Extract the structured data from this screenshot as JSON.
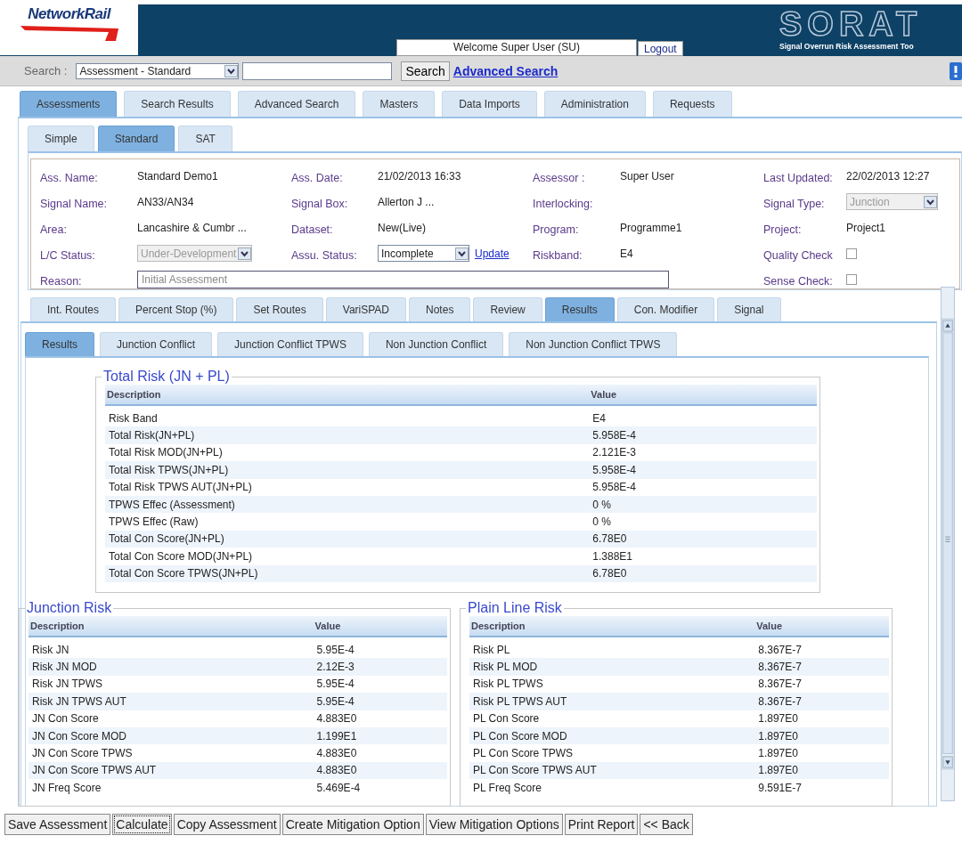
{
  "header": {
    "logo": "NetworkRail",
    "app_logo": "SORAT",
    "app_subtitle": "Signal Overrun Risk Assessment Too",
    "welcome": "Welcome Super User (SU)",
    "logout": "Logout"
  },
  "search": {
    "label": "Search :",
    "scope": "Assessment - Standard",
    "button": "Search",
    "advanced_link": "Advanced Search"
  },
  "main_tabs": [
    {
      "label": "Assessments",
      "selected": true
    },
    {
      "label": "Search Results",
      "selected": false
    },
    {
      "label": "Advanced Search",
      "selected": false
    },
    {
      "label": "Masters",
      "selected": false
    },
    {
      "label": "Data Imports",
      "selected": false
    },
    {
      "label": "Administration",
      "selected": false
    },
    {
      "label": "Requests",
      "selected": false
    }
  ],
  "sub_tabs": [
    {
      "label": "Simple",
      "selected": false
    },
    {
      "label": "Standard",
      "selected": true
    },
    {
      "label": "SAT",
      "selected": false
    }
  ],
  "form_rows": [
    [
      {
        "label": "Ass. Name:",
        "kind": "text",
        "value": "Standard Demo1"
      },
      {
        "label": "Ass. Date:",
        "kind": "text",
        "value": "21/02/2013 16:33"
      },
      {
        "label": "Assessor :",
        "kind": "text",
        "value": "Super User"
      },
      {
        "label": "Last Updated:",
        "kind": "text",
        "value": "22/02/2013 12:27"
      }
    ],
    [
      {
        "label": "Signal Name:",
        "kind": "text",
        "value": "AN33/AN34"
      },
      {
        "label": "Signal Box:",
        "kind": "text",
        "value": "Allerton J ..."
      },
      {
        "label": "Interlocking:",
        "kind": "text"
      },
      {
        "label": "Signal Type:",
        "kind": "select",
        "value": "Junction",
        "disabled": true
      }
    ],
    [
      {
        "label": "Area:",
        "kind": "text",
        "value": "Lancashire & Cumbr ..."
      },
      {
        "label": "Dataset:",
        "kind": "text",
        "value": "New(Live)"
      },
      {
        "label": "Program:",
        "kind": "text",
        "value": "Programme1"
      },
      {
        "label": "Project:",
        "kind": "text",
        "value": "Project1"
      }
    ],
    [
      {
        "label": "L/C Status:",
        "kind": "select",
        "value": "Under-Development",
        "disabled": true
      },
      {
        "label": "Assu. Status:",
        "kind": "select",
        "value": "Incomplete",
        "disabled": false,
        "link": "Update"
      },
      {
        "label": "Riskband:",
        "kind": "text",
        "value": "E4"
      },
      {
        "label": "Quality Check",
        "kind": "checkbox",
        "checked": false
      }
    ],
    [
      {
        "label": "Reason:",
        "kind": "input",
        "value": "Initial Assessment",
        "disabled": true
      },
      {
        "label": "Sense Check:",
        "kind": "checkbox",
        "checked": false
      }
    ]
  ],
  "detail_tabs": [
    {
      "label": "Int. Routes",
      "selected": false
    },
    {
      "label": "Percent Stop (%)",
      "selected": false
    },
    {
      "label": "Set Routes",
      "selected": false
    },
    {
      "label": "VariSPAD",
      "selected": false
    },
    {
      "label": "Notes",
      "selected": false
    },
    {
      "label": "Review",
      "selected": false
    },
    {
      "label": "Results",
      "selected": true
    },
    {
      "label": "Con. Modifier",
      "selected": false
    },
    {
      "label": "Signal",
      "selected": false
    }
  ],
  "result_tabs": [
    {
      "label": "Results",
      "selected": true
    },
    {
      "label": "Junction Conflict",
      "selected": false
    },
    {
      "label": "Junction Conflict TPWS",
      "selected": false
    },
    {
      "label": "Non Junction Conflict",
      "selected": false
    },
    {
      "label": "Non Junction Conflict TPWS",
      "selected": false
    }
  ],
  "total_risk": {
    "title": "Total Risk (JN + PL)",
    "columns": [
      "Description",
      "Value"
    ],
    "rows": [
      [
        "Risk Band",
        "E4"
      ],
      [
        "Total Risk(JN+PL)",
        "5.958E-4"
      ],
      [
        "Total Risk MOD(JN+PL)",
        "2.121E-3"
      ],
      [
        "Total Risk TPWS(JN+PL)",
        "5.958E-4"
      ],
      [
        "Total Risk TPWS AUT(JN+PL)",
        "5.958E-4"
      ],
      [
        "TPWS Effec (Assessment)",
        "0 %"
      ],
      [
        "TPWS Effec (Raw)",
        "0 %"
      ],
      [
        "Total Con Score(JN+PL)",
        "6.78E0"
      ],
      [
        "Total Con Score MOD(JN+PL)",
        "1.388E1"
      ],
      [
        "Total Con Score TPWS(JN+PL)",
        "6.78E0"
      ]
    ]
  },
  "junction_risk": {
    "title": "Junction Risk",
    "columns": [
      "Description",
      "Value"
    ],
    "rows": [
      [
        "Risk JN",
        "5.95E-4"
      ],
      [
        "Risk JN MOD",
        "2.12E-3"
      ],
      [
        "Risk JN TPWS",
        "5.95E-4"
      ],
      [
        "Risk JN TPWS AUT",
        "5.95E-4"
      ],
      [
        "JN Con Score",
        "4.883E0"
      ],
      [
        "JN Con Score MOD",
        "1.199E1"
      ],
      [
        "JN Con Score TPWS",
        "4.883E0"
      ],
      [
        "JN Con Score TPWS AUT",
        "4.883E0"
      ],
      [
        "JN Freq Score",
        "5.469E-4"
      ]
    ]
  },
  "plain_line_risk": {
    "title": "Plain Line Risk",
    "columns": [
      "Description",
      "Value"
    ],
    "rows": [
      [
        "Risk PL",
        "8.367E-7"
      ],
      [
        "Risk PL MOD",
        "8.367E-7"
      ],
      [
        "Risk PL TPWS",
        "8.367E-7"
      ],
      [
        "Risk PL TPWS AUT",
        "8.367E-7"
      ],
      [
        "PL Con Score",
        "1.897E0"
      ],
      [
        "PL Con Score MOD",
        "1.897E0"
      ],
      [
        "PL Con Score TPWS",
        "1.897E0"
      ],
      [
        "PL Con Score TPWS AUT",
        "1.897E0"
      ],
      [
        "PL Freq Score",
        "9.591E-7"
      ]
    ]
  },
  "buttons": [
    {
      "label": "Save Assessment",
      "focused": false
    },
    {
      "label": "Calculate",
      "focused": true
    },
    {
      "label": "Copy Assessment",
      "focused": false
    },
    {
      "label": "Create Mitigation Option",
      "focused": false
    },
    {
      "label": "View Mitigation Options",
      "focused": false
    },
    {
      "label": "Print Report",
      "focused": false
    },
    {
      "label": "<< Back",
      "focused": false
    }
  ]
}
